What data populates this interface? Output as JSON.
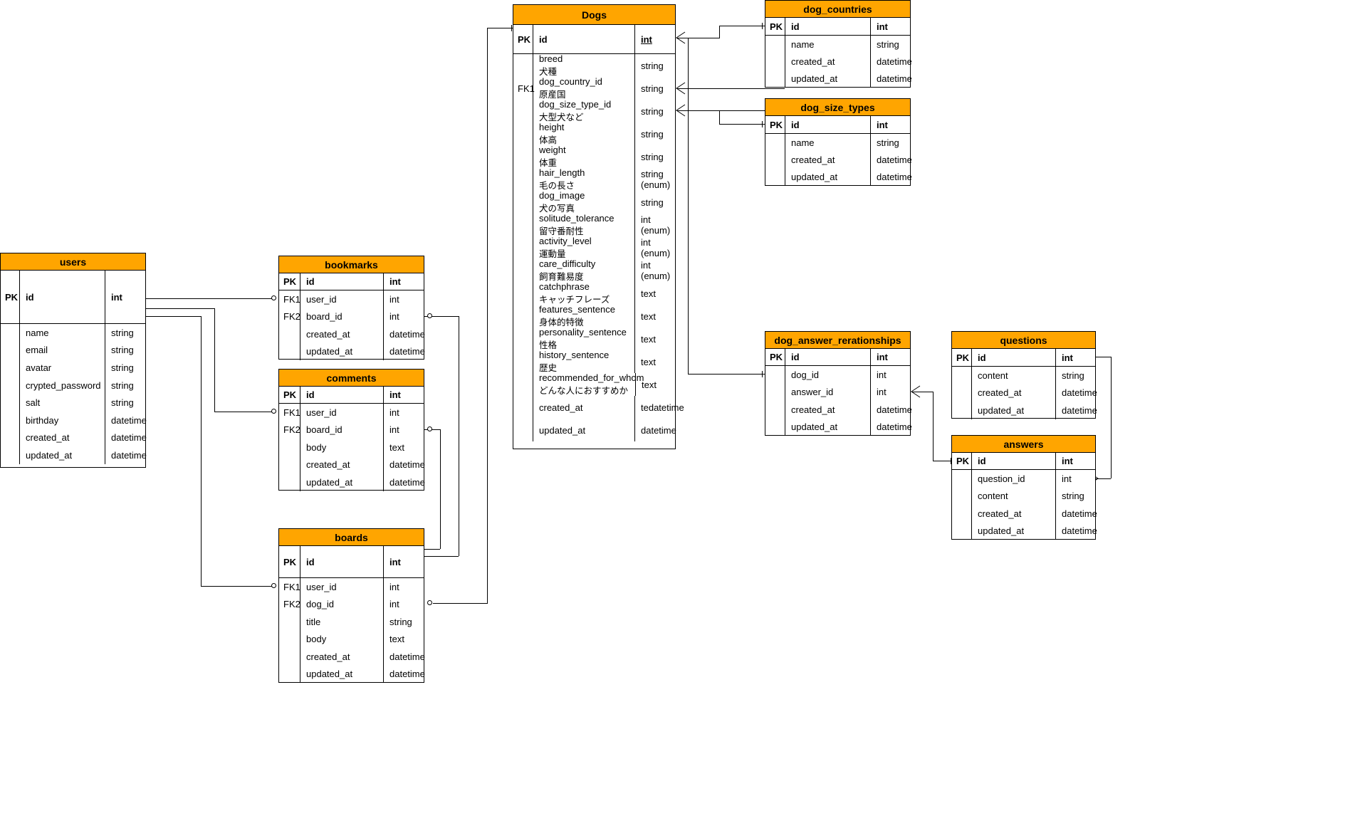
{
  "diagram": {
    "kind": "entity-relationship-diagram",
    "accent_header_color": "#FFA500",
    "line_color": "#000000",
    "background": "#FFFFFF",
    "key_labels": {
      "pk": "PK",
      "fk1": "FK1",
      "fk2": "FK2"
    }
  },
  "tables": {
    "dogs": {
      "title": "Dogs",
      "pk": {
        "key": "PK",
        "name": "id",
        "type": "int",
        "underline": true
      },
      "fields": [
        {
          "key": "",
          "name": "breed",
          "jp": "犬種",
          "type": "string"
        },
        {
          "key": "FK1",
          "name": "dog_country_id",
          "jp": "原産国",
          "type": "string"
        },
        {
          "key": "",
          "name": "dog_size_type_id",
          "jp": "大型犬など",
          "type": "string"
        },
        {
          "key": "",
          "name": "height",
          "jp": "体高",
          "type": "string"
        },
        {
          "key": "",
          "name": "weight",
          "jp": "体重",
          "type": "string"
        },
        {
          "key": "",
          "name": "hair_length",
          "jp": "毛の長さ",
          "type": "string\n(enum)"
        },
        {
          "key": "",
          "name": "dog_image",
          "jp": "犬の写真",
          "type": "string"
        },
        {
          "key": "",
          "name": "solitude_tolerance",
          "jp": "留守番耐性",
          "type": "int\n(enum)"
        },
        {
          "key": "",
          "name": "activity_level",
          "jp": "運動量",
          "type": "int\n(enum)"
        },
        {
          "key": "",
          "name": "care_difficulty",
          "jp": "飼育難易度",
          "type": "int\n(enum)"
        },
        {
          "key": "",
          "name": "catchphrase",
          "jp": "キャッチフレーズ",
          "type": "text"
        },
        {
          "key": "",
          "name": "features_sentence",
          "jp": "身体的特徴",
          "type": "text"
        },
        {
          "key": "",
          "name": "personality_sentence",
          "jp": "性格",
          "type": "text"
        },
        {
          "key": "",
          "name": "history_sentence",
          "jp": "歴史",
          "type": "text"
        },
        {
          "key": "",
          "name": "recommended_for_whom",
          "jp": "どんな人におすすめか",
          "type": "text"
        },
        {
          "key": "",
          "name": "created_at",
          "jp": "",
          "type": "tedatetime"
        },
        {
          "key": "",
          "name": "updated_at",
          "jp": "",
          "type": "datetime"
        }
      ]
    },
    "dog_countries": {
      "title": "dog_countries",
      "pk": {
        "key": "PK",
        "name": "id",
        "type": "int",
        "underline": false
      },
      "fields": [
        {
          "key": "",
          "name": "name",
          "jp": "",
          "type": "string"
        },
        {
          "key": "",
          "name": "created_at",
          "jp": "",
          "type": "datetime"
        },
        {
          "key": "",
          "name": "updated_at",
          "jp": "",
          "type": "datetime"
        }
      ]
    },
    "dog_size_types": {
      "title": "dog_size_types",
      "pk": {
        "key": "PK",
        "name": "id",
        "type": "int",
        "underline": false
      },
      "fields": [
        {
          "key": "",
          "name": "name",
          "jp": "",
          "type": "string"
        },
        {
          "key": "",
          "name": "created_at",
          "jp": "",
          "type": "datetime"
        },
        {
          "key": "",
          "name": "updated_at",
          "jp": "",
          "type": "datetime"
        }
      ]
    },
    "users": {
      "title": "users",
      "pk": {
        "key": "PK",
        "name": "id",
        "type": "int",
        "underline": false
      },
      "fields": [
        {
          "key": "",
          "name": "name",
          "jp": "",
          "type": "string"
        },
        {
          "key": "",
          "name": "email",
          "jp": "",
          "type": "string"
        },
        {
          "key": "",
          "name": "avatar",
          "jp": "",
          "type": "string"
        },
        {
          "key": "",
          "name": "crypted_password",
          "jp": "",
          "type": "string"
        },
        {
          "key": "",
          "name": "salt",
          "jp": "",
          "type": "string"
        },
        {
          "key": "",
          "name": "birthday",
          "jp": "",
          "type": "datetime"
        },
        {
          "key": "",
          "name": "created_at",
          "jp": "",
          "type": "datetime"
        },
        {
          "key": "",
          "name": "updated_at",
          "jp": "",
          "type": "datetime"
        }
      ]
    },
    "bookmarks": {
      "title": "bookmarks",
      "pk": {
        "key": "PK",
        "name": "id",
        "type": "int",
        "underline": false
      },
      "fields": [
        {
          "key": "FK1",
          "name": "user_id",
          "jp": "",
          "type": "int"
        },
        {
          "key": "FK2",
          "name": "board_id",
          "jp": "",
          "type": "int"
        },
        {
          "key": "",
          "name": "created_at",
          "jp": "",
          "type": "datetime"
        },
        {
          "key": "",
          "name": "updated_at",
          "jp": "",
          "type": "datetime"
        }
      ]
    },
    "comments": {
      "title": "comments",
      "pk": {
        "key": "PK",
        "name": "id",
        "type": "int",
        "underline": false
      },
      "fields": [
        {
          "key": "FK1",
          "name": "user_id",
          "jp": "",
          "type": "int"
        },
        {
          "key": "FK2",
          "name": "board_id",
          "jp": "",
          "type": "int"
        },
        {
          "key": "",
          "name": "body",
          "jp": "",
          "type": "text"
        },
        {
          "key": "",
          "name": "created_at",
          "jp": "",
          "type": "datetime"
        },
        {
          "key": "",
          "name": "updated_at",
          "jp": "",
          "type": "datetime"
        }
      ]
    },
    "boards": {
      "title": "boards",
      "pk": {
        "key": "PK",
        "name": "id",
        "type": "int",
        "underline": false
      },
      "fields": [
        {
          "key": "FK1",
          "name": "user_id",
          "jp": "",
          "type": "int"
        },
        {
          "key": "FK2",
          "name": "dog_id",
          "jp": "",
          "type": "int"
        },
        {
          "key": "",
          "name": "title",
          "jp": "",
          "type": "string"
        },
        {
          "key": "",
          "name": "body",
          "jp": "",
          "type": "text"
        },
        {
          "key": "",
          "name": "created_at",
          "jp": "",
          "type": "datetime"
        },
        {
          "key": "",
          "name": "updated_at",
          "jp": "",
          "type": "datetime"
        }
      ]
    },
    "dog_answer_rerationships": {
      "title": "dog_answer_rerationships",
      "pk": {
        "key": "PK",
        "name": "id",
        "type": "int",
        "underline": false
      },
      "fields": [
        {
          "key": "",
          "name": "dog_id",
          "jp": "",
          "type": "int"
        },
        {
          "key": "",
          "name": "answer_id",
          "jp": "",
          "type": "int"
        },
        {
          "key": "",
          "name": "created_at",
          "jp": "",
          "type": "datetime"
        },
        {
          "key": "",
          "name": "updated_at",
          "jp": "",
          "type": "datetime"
        }
      ]
    },
    "questions": {
      "title": "questions",
      "pk": {
        "key": "PK",
        "name": "id",
        "type": "int",
        "underline": false
      },
      "fields": [
        {
          "key": "",
          "name": "content",
          "jp": "",
          "type": "string"
        },
        {
          "key": "",
          "name": "created_at",
          "jp": "",
          "type": "datetime"
        },
        {
          "key": "",
          "name": "updated_at",
          "jp": "",
          "type": "datetime"
        }
      ]
    },
    "answers": {
      "title": "answers",
      "pk": {
        "key": "PK",
        "name": "id",
        "type": "int",
        "underline": false
      },
      "fields": [
        {
          "key": "",
          "name": "question_id",
          "jp": "",
          "type": "int"
        },
        {
          "key": "",
          "name": "content",
          "jp": "",
          "type": "string"
        },
        {
          "key": "",
          "name": "created_at",
          "jp": "",
          "type": "datetime"
        },
        {
          "key": "",
          "name": "updated_at",
          "jp": "",
          "type": "datetime"
        }
      ]
    }
  },
  "relationships": [
    {
      "from": "dogs.id",
      "to": "boards.dog_id",
      "from_card": "one",
      "to_card": "many"
    },
    {
      "from": "dog_countries.id",
      "to": "dogs.dog_country_id",
      "from_card": "one",
      "to_card": "many"
    },
    {
      "from": "dog_size_types.id",
      "to": "dogs.dog_size_type_id",
      "from_card": "one",
      "to_card": "many"
    },
    {
      "from": "dogs.id",
      "to": "dog_answer_rerationships.dog_id",
      "from_card": "one",
      "to_card": "many"
    },
    {
      "from": "users.id",
      "to": "bookmarks.user_id",
      "from_card": "one",
      "to_card": "many"
    },
    {
      "from": "users.id",
      "to": "comments.user_id",
      "from_card": "one",
      "to_card": "many"
    },
    {
      "from": "users.id",
      "to": "boards.user_id",
      "from_card": "one",
      "to_card": "many"
    },
    {
      "from": "boards.id",
      "to": "bookmarks.board_id",
      "from_card": "one",
      "to_card": "many"
    },
    {
      "from": "boards.id",
      "to": "comments.board_id",
      "from_card": "one",
      "to_card": "many"
    },
    {
      "from": "questions.id",
      "to": "answers.question_id",
      "from_card": "one",
      "to_card": "many"
    },
    {
      "from": "answers.id",
      "to": "dog_answer_rerationships.answer_id",
      "from_card": "one",
      "to_card": "many"
    }
  ]
}
